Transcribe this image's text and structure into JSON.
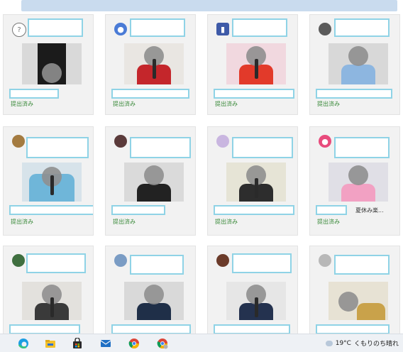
{
  "cards": [
    {
      "status": "提出済み",
      "note": "",
      "avatar_icon": "question-icon",
      "avatar_color": "#ffffff",
      "avatar_border": "#777777",
      "bg": "#d9d9d9",
      "shirt": "#1b1b1b"
    },
    {
      "status": "提出済み",
      "note": "",
      "avatar_icon": "person-icon",
      "avatar_color": "#4a7bd6",
      "avatar_border": "#4a7bd6",
      "bg": "#e9e6e2",
      "shirt": "#c4262b"
    },
    {
      "status": "提出済み",
      "note": "",
      "avatar_icon": "blue-square-icon",
      "avatar_color": "#3e5aa8",
      "avatar_border": "#3e5aa8",
      "bg": "#f1d8df",
      "shirt": "#e23a2a"
    },
    {
      "status": "提出済み",
      "note": "",
      "avatar_icon": "photo-avatar-icon",
      "avatar_color": "#5b5b5b",
      "avatar_border": "#5b5b5b",
      "bg": "#d8d8d8",
      "shirt": "#8db6e0"
    },
    {
      "status": "提出済み",
      "note": "",
      "avatar_icon": "pattern-avatar-icon",
      "avatar_color": "#a47b40",
      "avatar_border": "#a47b40",
      "bg": "#d7e3ea",
      "shirt": "#6fb6d9"
    },
    {
      "status": "提出済み",
      "note": "",
      "avatar_icon": "photo-avatar-icon",
      "avatar_color": "#5a3a3a",
      "avatar_border": "#5a3a3a",
      "bg": "#dadada",
      "shirt": "#222222"
    },
    {
      "status": "提出済み",
      "note": "",
      "avatar_icon": "anime-avatar-icon",
      "avatar_color": "#c9b6e0",
      "avatar_border": "#c9b6e0",
      "bg": "#e6e4d6",
      "shirt": "#2d2d2d"
    },
    {
      "status": "提出済み",
      "note": "夏休み楽...",
      "avatar_icon": "person-pink-icon",
      "avatar_color": "#e84b7c",
      "avatar_border": "#e84b7c",
      "bg": "#e0dfe6",
      "shirt": "#f2a1c3"
    },
    {
      "status": "",
      "note": "",
      "avatar_icon": "photo-avatar-icon",
      "avatar_color": "#3f6f3f",
      "avatar_border": "#3f6f3f",
      "bg": "#e3e1dd",
      "shirt": "#3a3a3a"
    },
    {
      "status": "",
      "note": "",
      "avatar_icon": "globe-avatar-icon",
      "avatar_color": "#7a9cc4",
      "avatar_border": "#7a9cc4",
      "bg": "#d9d9d9",
      "shirt": "#1f2f48"
    },
    {
      "status": "",
      "note": "",
      "avatar_icon": "photo-avatar-icon",
      "avatar_color": "#6b3b2a",
      "avatar_border": "#6b3b2a",
      "bg": "#e6e6e6",
      "shirt": "#24324f"
    },
    {
      "status": "",
      "note": "",
      "avatar_icon": "photo-avatar-icon",
      "avatar_color": "#b8b8b8",
      "avatar_border": "#b8b8b8",
      "bg": "#e7e2d4",
      "shirt": "#c9a24a"
    }
  ],
  "taskbar": {
    "weather_temp": "19°C",
    "weather_text": "くもりのち晴れ",
    "icons": [
      "edge-icon",
      "file-explorer-icon",
      "store-icon",
      "mail-icon",
      "chrome-icon",
      "chrome-icon"
    ]
  },
  "colors": {
    "accent_box": "#8fd3e6",
    "status_green": "#3a8a3a"
  }
}
